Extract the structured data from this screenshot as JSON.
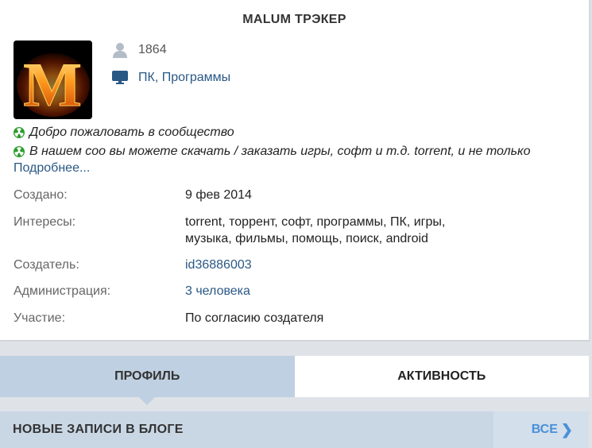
{
  "header": {
    "title": "MALUM ТРЭКЕР"
  },
  "avatar": {
    "letter": "M"
  },
  "stats": {
    "members": "1864",
    "category": "ПК, Программы"
  },
  "description": {
    "lines": [
      "Добро пожаловать в сообщество",
      "В нашем соо вы можете скачать / заказать игры, софт и т.д. torrent, и не только"
    ],
    "more_link": "Подробнее..."
  },
  "info": {
    "created_label": "Создано:",
    "created_value": "9 фев 2014",
    "interests_label": "Интересы:",
    "interests_line1": "torrent, торрент, софт, программы, ПК, игры,",
    "interests_line2": "музыка, фильмы, помощь, поиск, android",
    "creator_label": "Создатель:",
    "creator_value": "id36886003",
    "admin_label": "Администрация:",
    "admin_value": "3 человека",
    "participation_label": "Участие:",
    "participation_value": "По согласию создателя"
  },
  "tabs": [
    {
      "label": "ПРОФИЛЬ",
      "active": true
    },
    {
      "label": "АКТИВНОСТЬ",
      "active": false
    }
  ],
  "blog": {
    "title": "НОВЫЕ ЗАПИСИ В БЛОГЕ",
    "all_label": "ВСЕ"
  },
  "colors": {
    "link": "#2a5885",
    "active_tab": "#bfd0e2",
    "accent": "#4a90d9",
    "radiation_icon": "#2e9e2e"
  }
}
